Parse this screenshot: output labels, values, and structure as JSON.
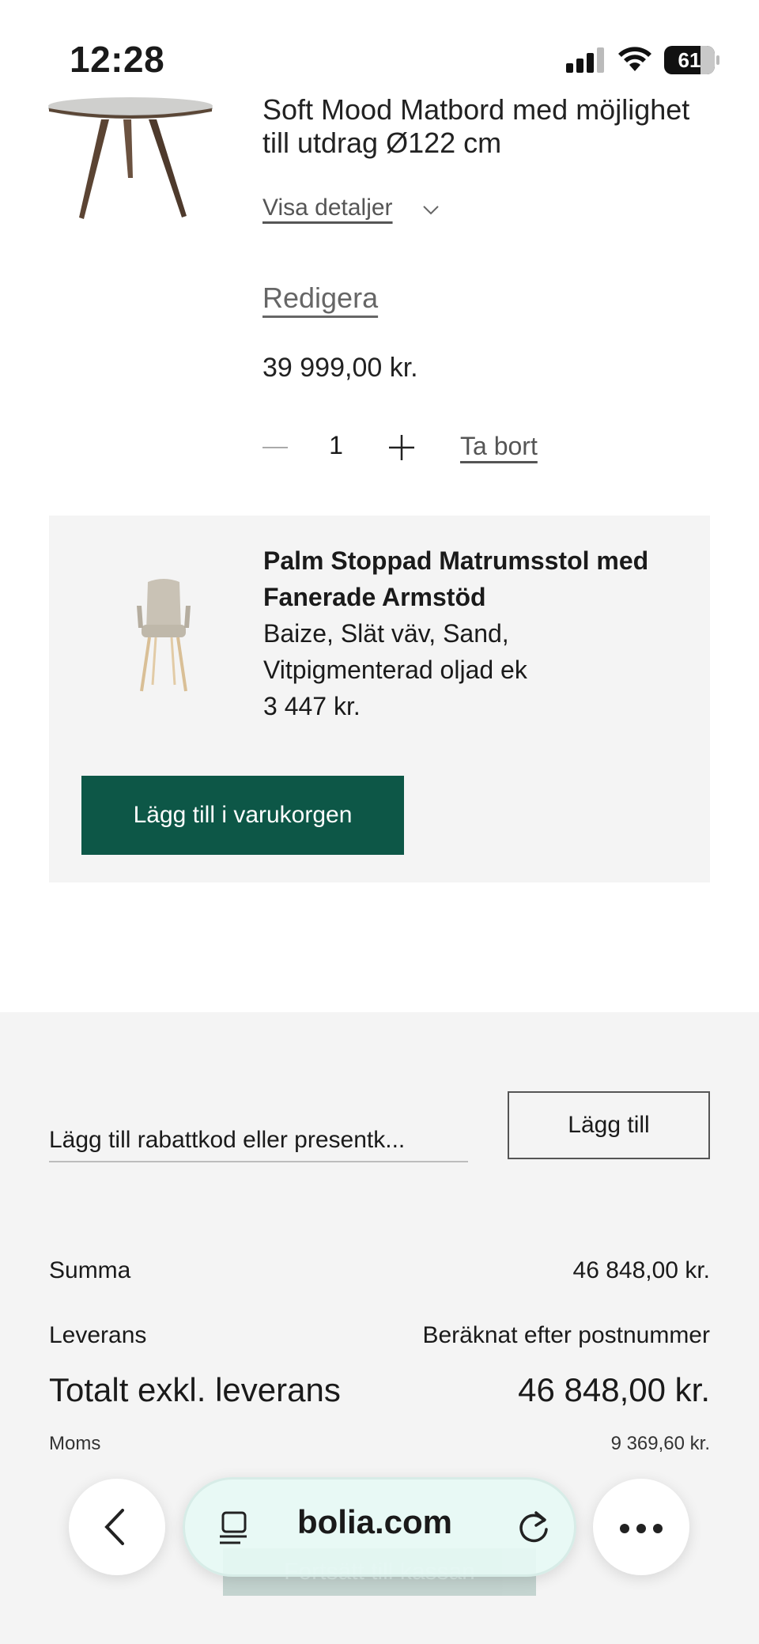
{
  "status_bar": {
    "time": "12:28",
    "battery": "61"
  },
  "product": {
    "title": "Soft Mood Matbord med möjlighet till utdrag Ø122 cm",
    "details_label": "Visa detaljer",
    "edit_label": "Redigera",
    "price": "39 999,00 kr.",
    "quantity": "1",
    "remove_label": "Ta bort"
  },
  "upsell": {
    "title": "Palm Stoppad Matrumsstol med Fanerade Armstöd",
    "variant": "Baize, Slät väv, Sand, Vitpigmenterad oljad ek",
    "price": "3 447 kr.",
    "add_button": "Lägg till i varukorgen",
    "button_color": "#0d5747"
  },
  "discount": {
    "placeholder": "Lägg till rabattkod eller presentk...",
    "button": "Lägg till"
  },
  "summary": {
    "summa_label": "Summa",
    "summa_value": "46 848,00 kr.",
    "leverans_label": "Leverans",
    "leverans_value": "Beräknat efter postnummer",
    "total_label": "Totalt exkl. leverans",
    "total_value": "46 848,00 kr.",
    "moms_label": "Moms",
    "moms_value": "9 369,60 kr."
  },
  "browser": {
    "url": "bolia.com",
    "hidden_cta": "Fortsätt till kassan"
  }
}
